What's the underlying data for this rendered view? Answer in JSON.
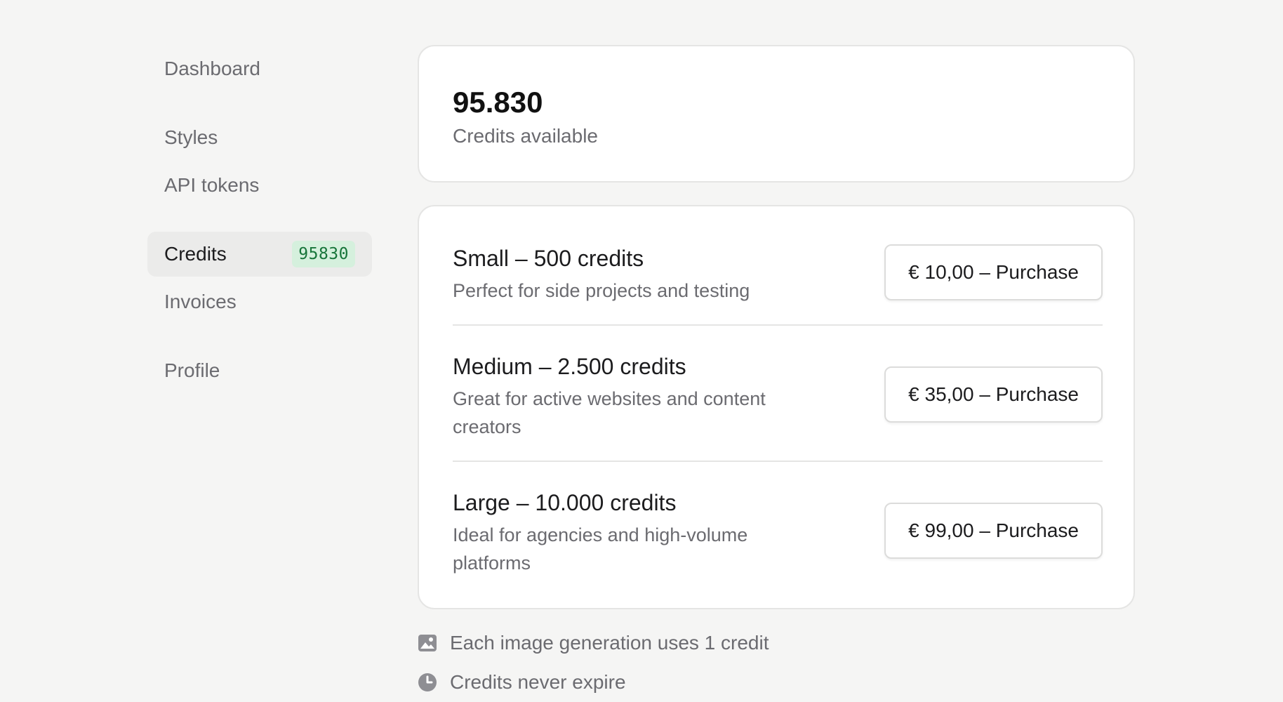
{
  "sidebar": {
    "items": [
      {
        "id": "dashboard",
        "label": "Dashboard"
      },
      {
        "id": "styles",
        "label": "Styles"
      },
      {
        "id": "api-tokens",
        "label": "API tokens"
      },
      {
        "id": "credits",
        "label": "Credits",
        "badge": "95830",
        "active": true
      },
      {
        "id": "invoices",
        "label": "Invoices"
      },
      {
        "id": "profile",
        "label": "Profile"
      }
    ]
  },
  "balance": {
    "amount": "95.830",
    "label": "Credits available"
  },
  "packages": [
    {
      "title": "Small – 500 credits",
      "description": "Perfect for side projects and testing",
      "button_label": "€ 10,00 – Purchase"
    },
    {
      "title": "Medium – 2.500 credits",
      "description": "Great for active websites and content creators",
      "button_label": "€ 35,00 – Purchase"
    },
    {
      "title": "Large – 10.000 credits",
      "description": "Ideal for agencies and high-volume platforms",
      "button_label": "€ 99,00 – Purchase"
    }
  ],
  "notes": [
    {
      "icon": "image-icon",
      "text": "Each image generation uses 1 credit"
    },
    {
      "icon": "clock-icon",
      "text": "Credits never expire"
    }
  ],
  "colors": {
    "background": "#f5f5f4",
    "badge_bg": "#d5f0dd",
    "badge_text": "#17753a"
  }
}
